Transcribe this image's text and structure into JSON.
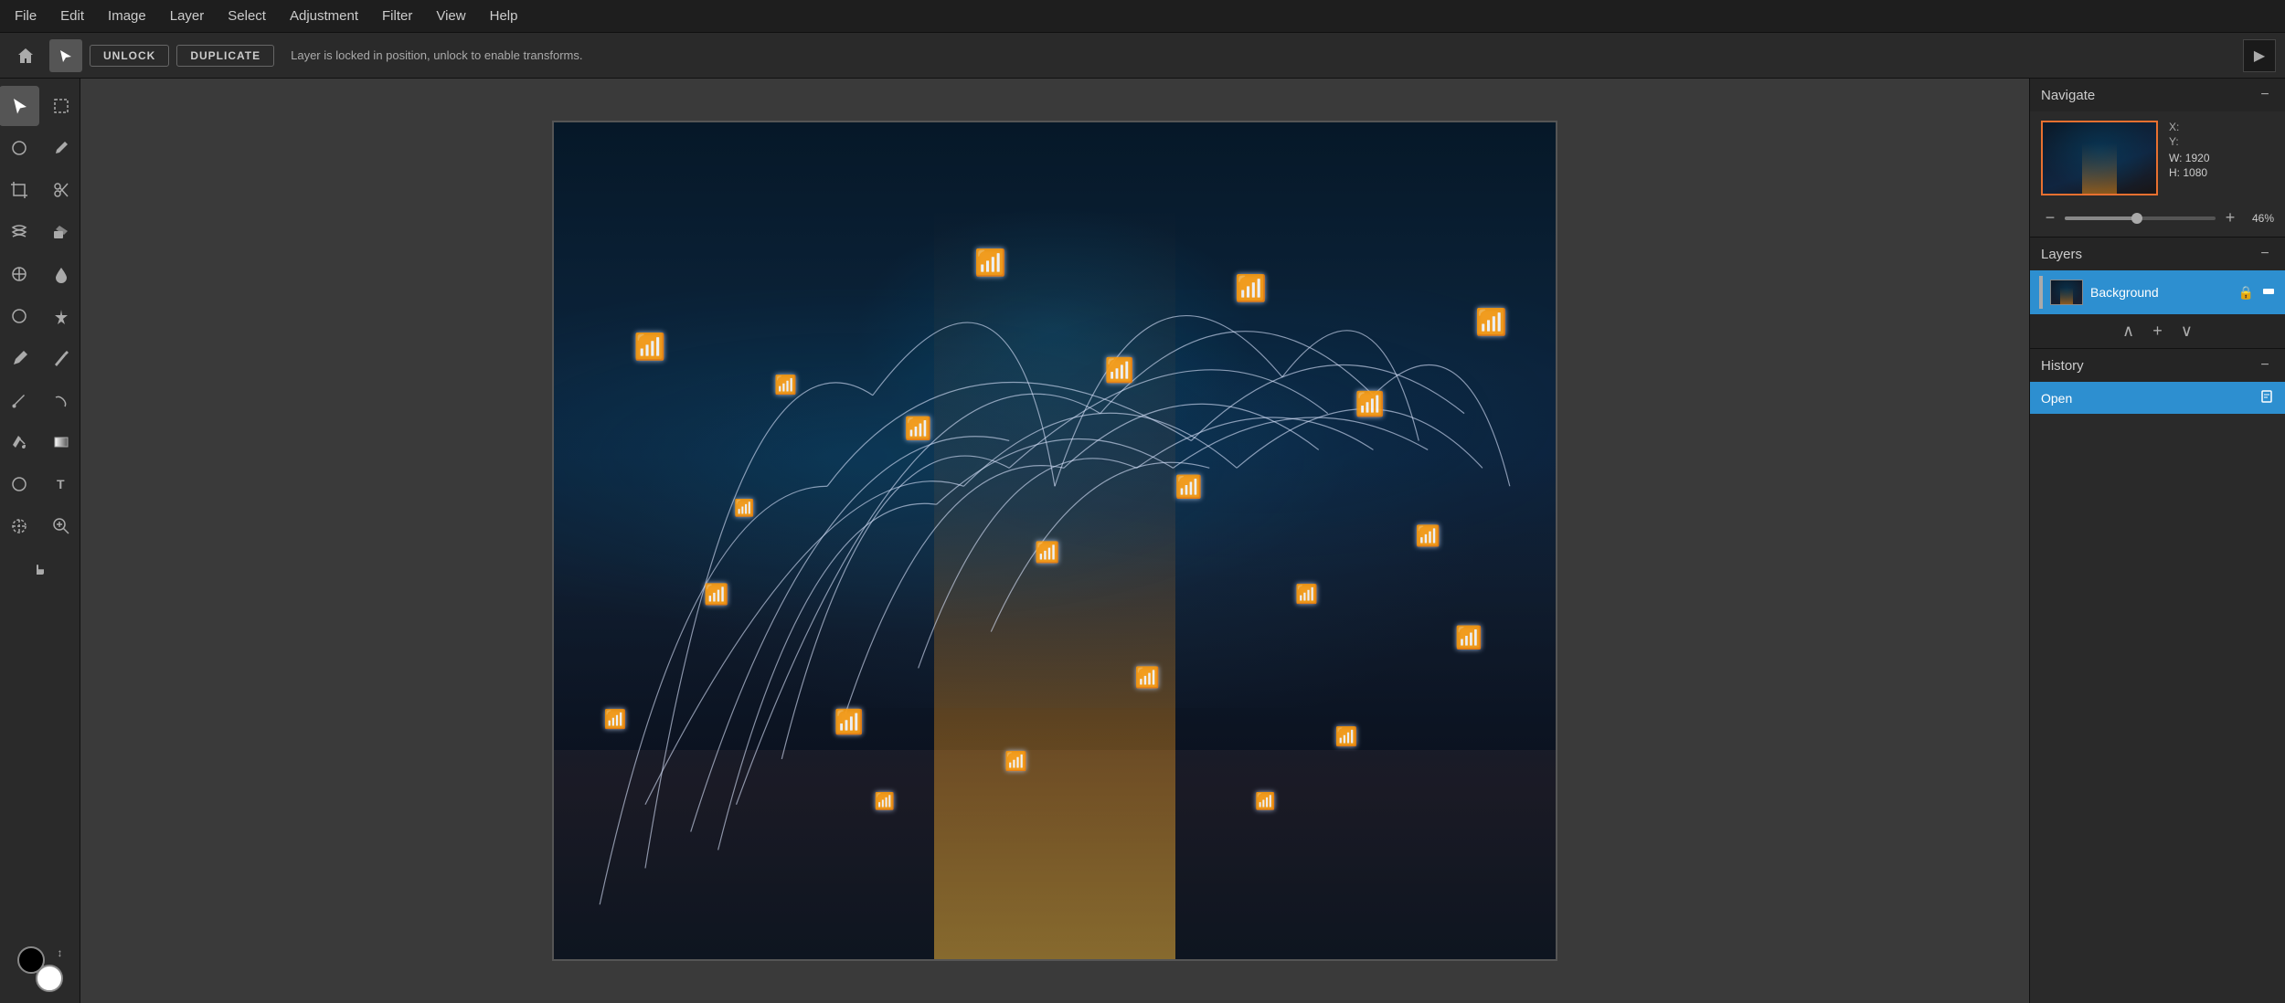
{
  "menubar": {
    "items": [
      "File",
      "Edit",
      "Image",
      "Layer",
      "Select",
      "Adjustment",
      "Filter",
      "View",
      "Help"
    ]
  },
  "toolbar": {
    "home_icon": "⌂",
    "arrow_icon": "↖",
    "unlock_label": "UNLOCK",
    "duplicate_label": "DUPLICATE",
    "message": "Layer is locked in position, unlock to enable transforms.",
    "end_icon": "▶"
  },
  "left_tools": {
    "tools": [
      {
        "id": "select",
        "icon": "↖",
        "active": true
      },
      {
        "id": "marquee",
        "icon": "⬚",
        "active": false
      },
      {
        "id": "lasso",
        "icon": "◯",
        "active": false
      },
      {
        "id": "eyedrop",
        "icon": "✒",
        "active": false
      },
      {
        "id": "crop",
        "icon": "⊡",
        "active": false
      },
      {
        "id": "scissors",
        "icon": "✂",
        "active": false
      },
      {
        "id": "warp",
        "icon": "≋",
        "active": false
      },
      {
        "id": "eraser",
        "icon": "◻",
        "active": false
      },
      {
        "id": "stamp",
        "icon": "⊕",
        "active": false
      },
      {
        "id": "waterdrop",
        "icon": "◉",
        "active": false
      },
      {
        "id": "dodge",
        "icon": "○",
        "active": false
      },
      {
        "id": "sharpen",
        "icon": "✳",
        "active": false
      },
      {
        "id": "pen",
        "icon": "✏",
        "active": false
      },
      {
        "id": "pencil",
        "icon": "⌄",
        "active": false
      },
      {
        "id": "brush",
        "icon": "∿",
        "active": false
      },
      {
        "id": "smudge",
        "icon": "⌇",
        "active": false
      },
      {
        "id": "paint-bucket",
        "icon": "△",
        "active": false
      },
      {
        "id": "gradient",
        "icon": "⬜",
        "active": false
      },
      {
        "id": "shape",
        "icon": "◇",
        "active": false
      },
      {
        "id": "text",
        "icon": "T",
        "active": false
      },
      {
        "id": "pen2",
        "icon": "⊘",
        "active": false
      },
      {
        "id": "eyedrop2",
        "icon": "🔍",
        "active": false
      },
      {
        "id": "hand",
        "icon": "✋",
        "active": false
      }
    ]
  },
  "navigate": {
    "title": "Navigate",
    "minimize": "−",
    "x_label": "X:",
    "y_label": "Y:",
    "w_label": "W:",
    "h_label": "H:",
    "w_value": "1920",
    "h_value": "1080",
    "zoom_minus": "−",
    "zoom_plus": "+",
    "zoom_percent": "46%",
    "zoom_level": 46
  },
  "layers": {
    "title": "Layers",
    "minimize": "−",
    "items": [
      {
        "id": "background",
        "name": "Background",
        "active": true,
        "locked": true,
        "visible": true
      }
    ],
    "up_icon": "∧",
    "add_icon": "+",
    "down_icon": "∨"
  },
  "history": {
    "title": "History",
    "minimize": "−",
    "items": [
      {
        "id": "open",
        "label": "Open",
        "icon": "📋",
        "active": true
      }
    ]
  },
  "colors": {
    "foreground": "#000000",
    "background": "#ffffff",
    "accent_blue": "#2d8fd0",
    "active_layer_bg": "#2d8fd0"
  }
}
